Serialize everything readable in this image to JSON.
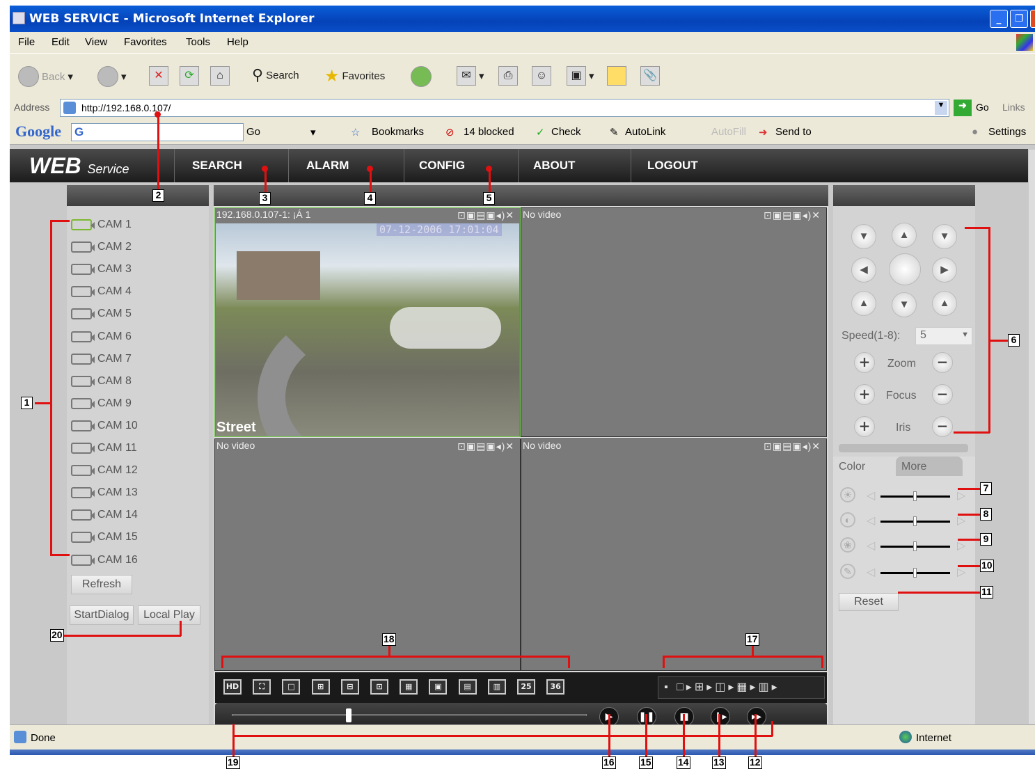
{
  "window": {
    "title": "WEB SERVICE - Microsoft Internet Explorer"
  },
  "menu": [
    "File",
    "Edit",
    "View",
    "Favorites",
    "Tools",
    "Help"
  ],
  "toolbar": {
    "back": "Back",
    "search": "Search",
    "favorites": "Favorites"
  },
  "address": {
    "label": "Address",
    "url": "http://192.168.0.107/",
    "go": "Go",
    "links": "Links"
  },
  "googlebar": {
    "google": "Google",
    "search_field": "G",
    "go": "Go",
    "bookmarks": "Bookmarks",
    "blocked": "14 blocked",
    "check": "Check",
    "autolink": "AutoLink",
    "autofill": "AutoFill",
    "sendto": "Send to",
    "settings": "Settings"
  },
  "app": {
    "logo": "WEB",
    "logo_sub": "Service",
    "nav": [
      "SEARCH",
      "ALARM",
      "CONFIG",
      "ABOUT",
      "LOGOUT"
    ],
    "cameras": [
      "CAM 1",
      "CAM 2",
      "CAM 3",
      "CAM 4",
      "CAM 5",
      "CAM 6",
      "CAM 7",
      "CAM 8",
      "CAM 9",
      "CAM 10",
      "CAM 11",
      "CAM 12",
      "CAM 13",
      "CAM 14",
      "CAM 15",
      "CAM 16"
    ],
    "refresh": "Refresh",
    "start_dialog": "StartDialog",
    "local_play": "Local Play",
    "panes": [
      {
        "label": "192.168.0.107-1: ¡Á 1",
        "timestamp": "07-12-2006 17:01:04",
        "caption": "Street"
      },
      {
        "label": "No video"
      },
      {
        "label": "No video"
      },
      {
        "label": "No video"
      }
    ],
    "grid_buttons": [
      "HD",
      "⛶",
      "□",
      "⊞",
      "⊟",
      "⊡",
      "▦",
      "▣",
      "▤",
      "▥",
      "25",
      "36"
    ],
    "playback": {
      "position": 0.33
    },
    "ptz": {
      "speed_label": "Speed(1-8):",
      "speed_value": "5",
      "zoom": "Zoom",
      "focus": "Focus",
      "iris": "Iris"
    },
    "color": {
      "tab_color": "Color",
      "tab_more": "More",
      "reset": "Reset",
      "brightness": 0.5,
      "contrast": 0.5,
      "saturation": 0.5,
      "hue": 0.5
    }
  },
  "status": {
    "done": "Done",
    "zone": "Internet"
  },
  "annotations": [
    "1",
    "2",
    "3",
    "4",
    "5",
    "6",
    "7",
    "8",
    "9",
    "10",
    "11",
    "12",
    "13",
    "14",
    "15",
    "16",
    "17",
    "18",
    "19",
    "20"
  ]
}
